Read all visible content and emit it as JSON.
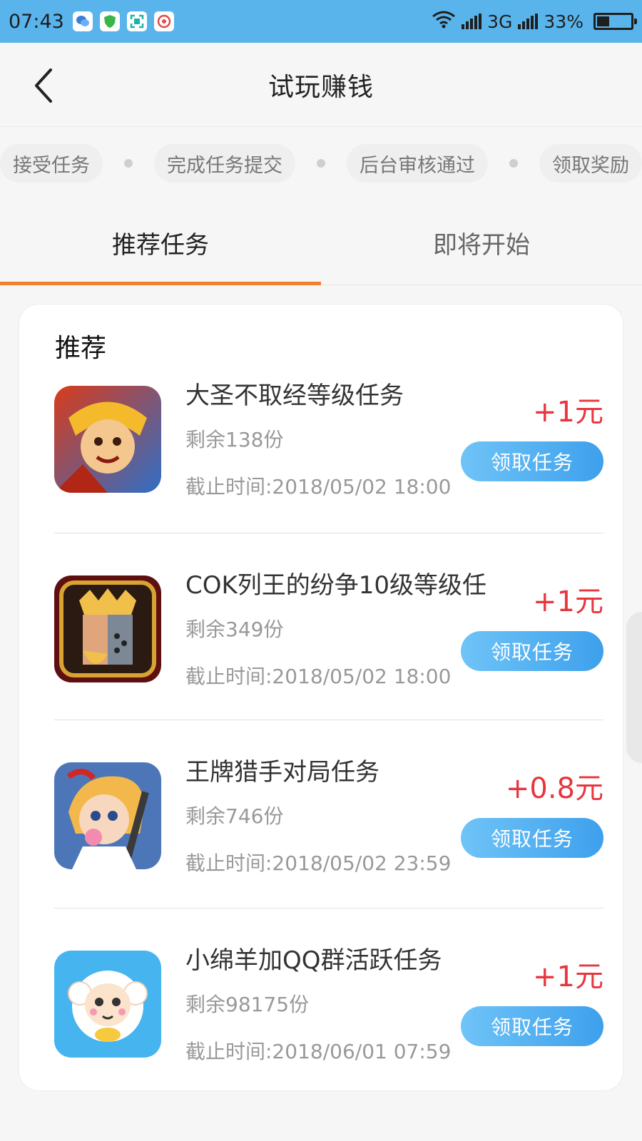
{
  "status_bar": {
    "time": "07:43",
    "network": "3G",
    "battery": "33%",
    "battery_level": 0.33,
    "app_icons": [
      "wechat-icon",
      "security-shield-icon",
      "scan-icon",
      "weibo-icon"
    ]
  },
  "header": {
    "title": "试玩赚钱"
  },
  "steps": [
    {
      "label": "接受任务"
    },
    {
      "label": "完成任务提交"
    },
    {
      "label": "后台审核通过"
    },
    {
      "label": "领取奖励"
    }
  ],
  "tabs": [
    {
      "label": "推荐任务",
      "active": true
    },
    {
      "label": "即将开始",
      "active": false
    }
  ],
  "section": {
    "title": "推荐"
  },
  "tasks": [
    {
      "name": "大圣不取经等级任务",
      "remaining": "剩余138份",
      "deadline": "截止时间:2018/05/02 18:00",
      "reward": "+1元",
      "button": "领取任务",
      "icon": "monkey-king-game-icon"
    },
    {
      "name": "COK列王的纷争10级等级任",
      "remaining": "剩余349份",
      "deadline": "截止时间:2018/05/02 18:00",
      "reward": "+1元",
      "button": "领取任务",
      "icon": "clash-of-kings-game-icon"
    },
    {
      "name": "王牌猎手对局任务",
      "remaining": "剩余746份",
      "deadline": "截止时间:2018/05/02 23:59",
      "reward": "+0.8元",
      "button": "领取任务",
      "icon": "ace-hunter-game-icon"
    },
    {
      "name": "小绵羊加QQ群活跃任务",
      "remaining": "剩余98175份",
      "deadline": "截止时间:2018/06/01 07:59",
      "reward": "+1元",
      "button": "领取任务",
      "icon": "little-sheep-app-icon"
    }
  ],
  "colors": {
    "status_bar": "#5ab4ec",
    "accent_tab": "#f0822e",
    "reward": "#e8363f",
    "button_start": "#6fc4f7",
    "button_end": "#3ea0ec"
  }
}
